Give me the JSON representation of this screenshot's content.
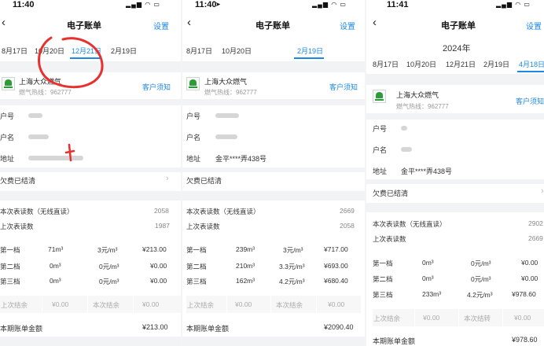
{
  "screens": [
    {
      "status_time": "11:40",
      "title": "电子账单",
      "settings": "设置",
      "tabs": [
        "8月17日",
        "10月20日",
        "12月21日",
        "2月19日"
      ],
      "active_tab": "12月21日",
      "company": "上海大众燃气",
      "hotline": "燃气热线：962777",
      "notice": "客户须知",
      "account_rows": [
        {
          "label": "户号",
          "value": ""
        },
        {
          "label": "户名",
          "value": ""
        },
        {
          "label": "地址",
          "value": ""
        }
      ],
      "arrears": "欠费已结清",
      "meter_current": {
        "label": "本次表读数（无线直读）",
        "value": "2058"
      },
      "meter_last": {
        "label": "上次表读数",
        "value": "1987"
      },
      "tiers": [
        {
          "name": "第一档",
          "usage": "71m³",
          "price": "3元/m³",
          "amount": "¥213.00"
        },
        {
          "name": "第二档",
          "usage": "0m³",
          "price": "0元/m³",
          "amount": "¥0.00"
        },
        {
          "name": "第三档",
          "usage": "0m³",
          "price": "0元/m³",
          "amount": "¥0.00"
        }
      ],
      "balances": [
        "上次结余",
        "¥0.00",
        "本次结余",
        "¥0.00"
      ],
      "total_label": "本期账单金额",
      "total_value": "¥213.00"
    },
    {
      "status_time": "11:40",
      "title": "电子账单",
      "settings": "设置",
      "tabs": [
        "8月17日",
        "10月20日",
        "2月19日"
      ],
      "active_tab": "2月19日",
      "company": "上海大众燃气",
      "hotline": "燃气热线：962777",
      "notice": "客户须知",
      "account_rows": [
        {
          "label": "户号",
          "value": ""
        },
        {
          "label": "户名",
          "value": ""
        },
        {
          "label": "地址",
          "value": "金平****弄438号"
        }
      ],
      "arrears": "欠费已结清",
      "meter_current": {
        "label": "本次表读数（无线直读）",
        "value": "2669"
      },
      "meter_last": {
        "label": "上次表读数",
        "value": "2058"
      },
      "tiers": [
        {
          "name": "第一档",
          "usage": "239m³",
          "price": "3元/m³",
          "amount": "¥717.00"
        },
        {
          "name": "第二档",
          "usage": "210m³",
          "price": "3.3元/m³",
          "amount": "¥693.00"
        },
        {
          "name": "第三档",
          "usage": "162m³",
          "price": "4.2元/m³",
          "amount": "¥680.40"
        }
      ],
      "balances": [
        "上次结余",
        "¥0.00",
        "本次结余",
        "¥0.00"
      ],
      "total_label": "本期账单金额",
      "total_value": "¥2090.40"
    },
    {
      "status_time": "11:41",
      "title": "电子账单",
      "settings": "设置",
      "year": "2024年",
      "tabs": [
        "8月17日",
        "10月20日",
        "12月21日",
        "2月19日",
        "4月18日"
      ],
      "active_tab": "4月18日",
      "company": "上海大众燃气",
      "hotline": "燃气热线：962777",
      "notice": "客户须知",
      "account_rows": [
        {
          "label": "户号",
          "value": ""
        },
        {
          "label": "户名",
          "value": ""
        },
        {
          "label": "地址",
          "value": "金平****弄438号"
        }
      ],
      "arrears": "欠费已结清",
      "meter_current": {
        "label": "本次表读数（无线直读）",
        "value": "2902"
      },
      "meter_last": {
        "label": "上次表读数",
        "value": "2669"
      },
      "tiers": [
        {
          "name": "第一档",
          "usage": "0m³",
          "price": "0元/m³",
          "amount": "¥0.00"
        },
        {
          "name": "第二档",
          "usage": "0m³",
          "price": "0元/m³",
          "amount": "¥0.00"
        },
        {
          "name": "第三档",
          "usage": "233m³",
          "price": "4.2元/m³",
          "amount": "¥978.60"
        }
      ],
      "balances": [
        "上次结余",
        "¥0.00",
        "本次结转",
        "¥0.00"
      ],
      "total_label": "本期账单金额",
      "total_value": "¥978.60"
    }
  ]
}
